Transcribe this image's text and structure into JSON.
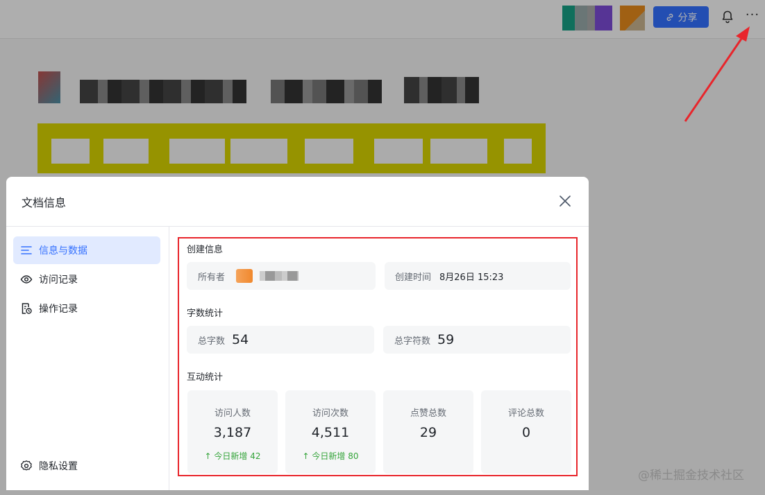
{
  "topbar": {
    "share_label": "分享",
    "more_label": "···"
  },
  "modal": {
    "title": "文档信息",
    "sidebar": {
      "items": [
        {
          "label": "信息与数据",
          "icon": "list-icon",
          "active": true
        },
        {
          "label": "访问记录",
          "icon": "eye-icon",
          "active": false
        },
        {
          "label": "操作记录",
          "icon": "file-clock-icon",
          "active": false
        }
      ],
      "footer": {
        "label": "隐私设置",
        "icon": "gear-icon"
      }
    },
    "create_info": {
      "section_title": "创建信息",
      "owner_label": "所有者",
      "created_label": "创建时间",
      "created_value": "8月26日 15:23"
    },
    "word_stats": {
      "section_title": "字数统计",
      "total_words_label": "总字数",
      "total_words_value": "54",
      "total_chars_label": "总字符数",
      "total_chars_value": "59"
    },
    "interaction": {
      "section_title": "互动统计",
      "stats": [
        {
          "label": "访问人数",
          "value": "3,187",
          "delta": "今日新增 42"
        },
        {
          "label": "访问次数",
          "value": "4,511",
          "delta": "今日新增 80"
        },
        {
          "label": "点赞总数",
          "value": "29",
          "delta": ""
        },
        {
          "label": "评论总数",
          "value": "0",
          "delta": ""
        }
      ]
    }
  },
  "watermark": "@稀土掘金技术社区",
  "colors": {
    "accent": "#3370ff",
    "annotation_red": "#e8252b",
    "positive_green": "#34a43a"
  }
}
